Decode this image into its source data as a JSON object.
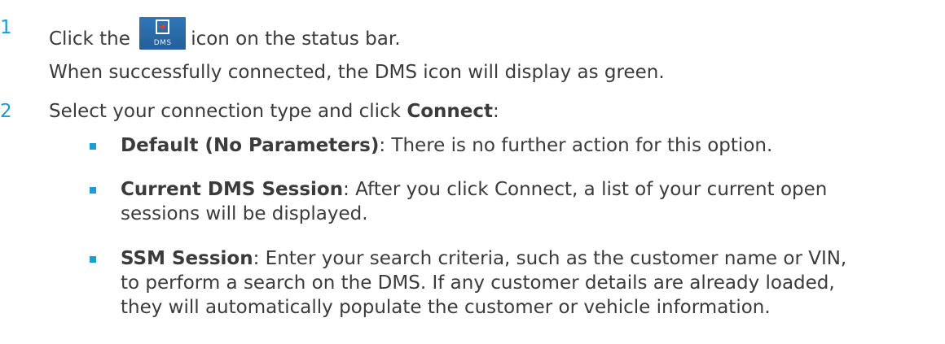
{
  "steps": [
    {
      "number": "1",
      "text_before": "Click the",
      "text_after": "icon on the status bar.",
      "icon_name": "dms-icon",
      "icon_label": "DMS",
      "note": "When successfully connected, the DMS icon will display as green."
    },
    {
      "number": "2",
      "text_before": "Select your connection type and click",
      "bold": "Connect",
      "text_after": ":"
    }
  ],
  "options": [
    {
      "title": "Default (No Parameters)",
      "desc_lines": [
        ": There is no further action for this option."
      ]
    },
    {
      "title": "Current DMS Session",
      "desc_lines": [
        ": After you click Connect, a list of your current open",
        "sessions will be displayed."
      ]
    },
    {
      "title": "SSM Session",
      "desc_lines": [
        ": Enter your search criteria, such as the customer name or VIN,",
        "to perform a search on the DMS. If any customer details are already loaded,",
        "they will automatically populate the customer or vehicle information."
      ]
    }
  ],
  "colors": {
    "accent": "#1a9cd6",
    "text": "#3b3b3b",
    "icon_bg": "#2a6aa8"
  }
}
